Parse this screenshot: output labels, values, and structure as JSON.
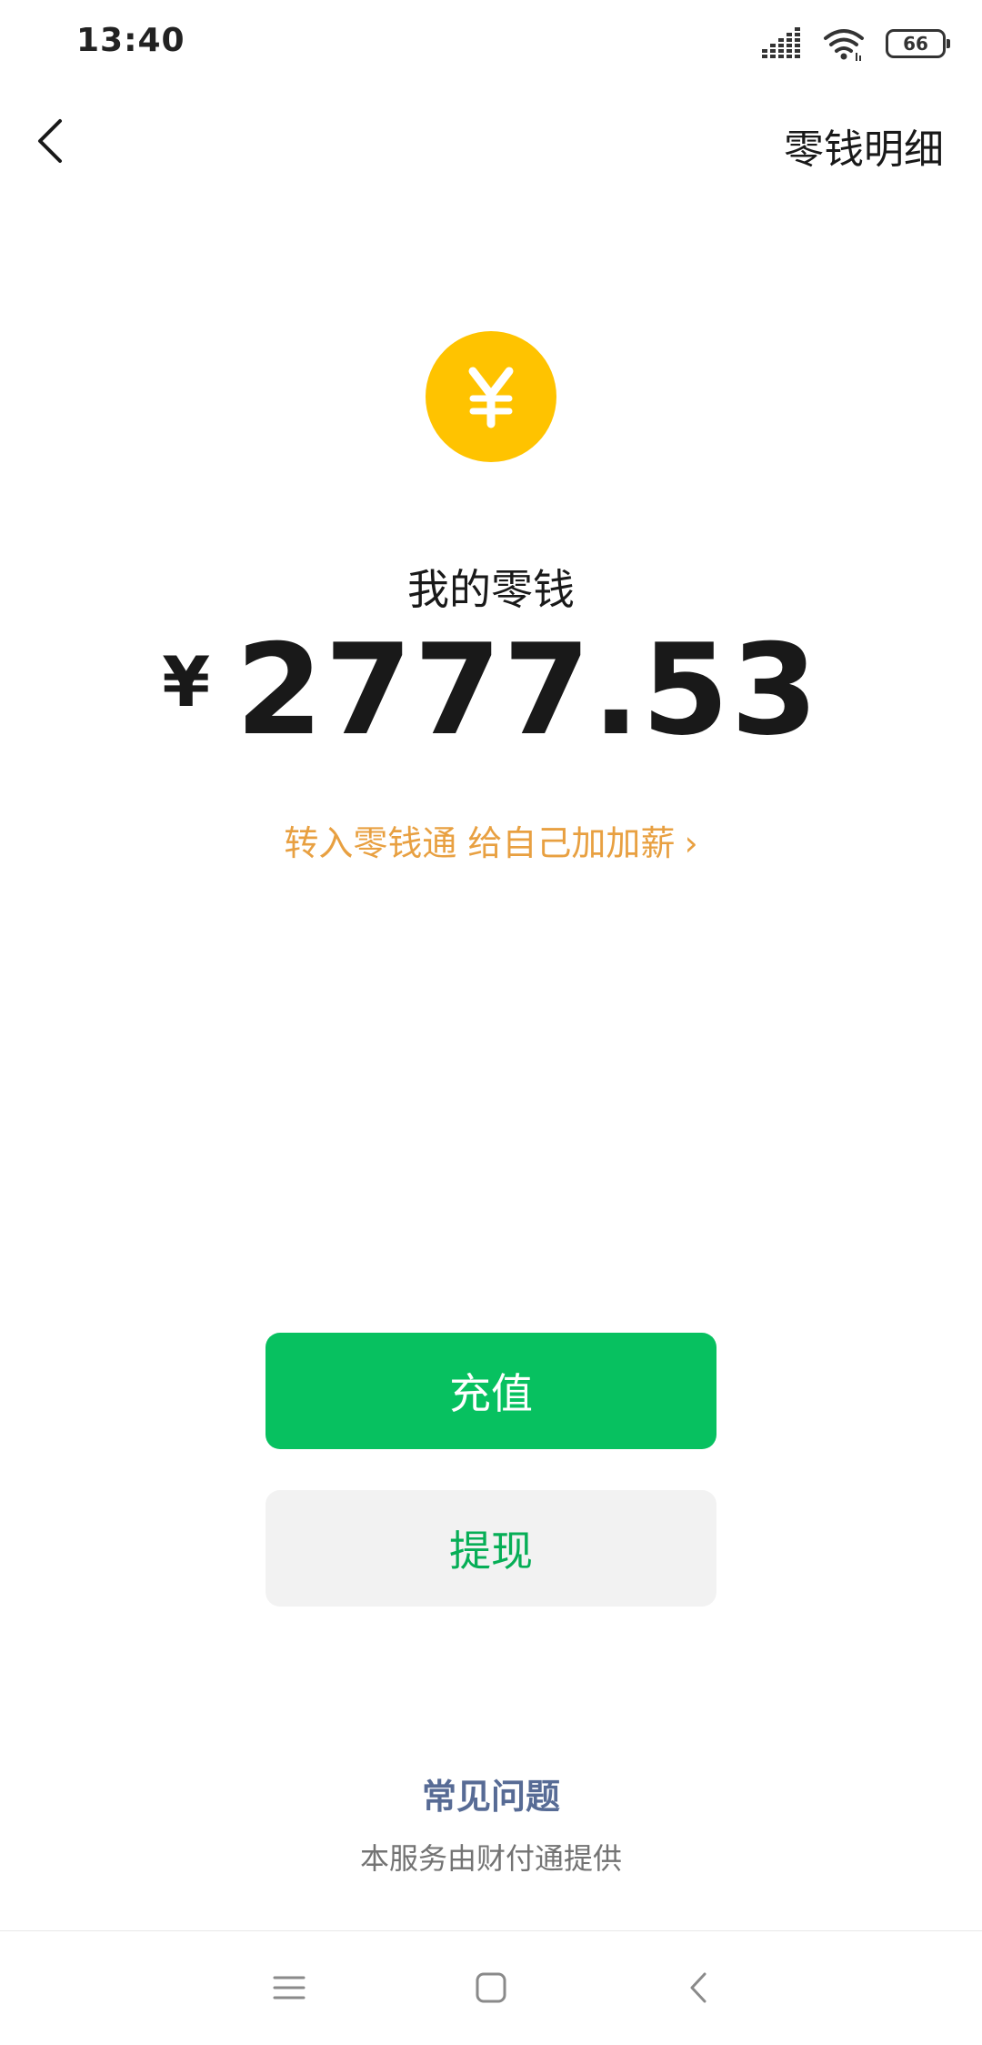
{
  "status_bar": {
    "time": "13:40",
    "battery_level": "66",
    "icons": [
      "signal-icon",
      "wifi-icon",
      "battery-icon"
    ]
  },
  "nav": {
    "back_icon": "chevron-left-icon",
    "detail_label": "零钱明细"
  },
  "wallet": {
    "coin_icon": "yuan-coin-icon",
    "label": "我的零钱",
    "currency_symbol": "¥",
    "amount": "2777.53",
    "promo_text": "转入零钱通 给自己加加薪",
    "promo_chevron": "›"
  },
  "actions": {
    "recharge_label": "充值",
    "withdraw_label": "提现"
  },
  "footer": {
    "faq_label": "常见问题",
    "provider_note": "本服务由财付通提供"
  },
  "system_nav": {
    "icons": [
      "menu-icon",
      "home-icon",
      "back-icon"
    ]
  },
  "colors": {
    "primary_green": "#07C160",
    "withdraw_text_green": "#06AE56",
    "coin_yellow": "#FFC300",
    "promo_orange": "#E8A041",
    "link_blue": "#576B95",
    "secondary_button_bg": "#F2F2F2"
  }
}
